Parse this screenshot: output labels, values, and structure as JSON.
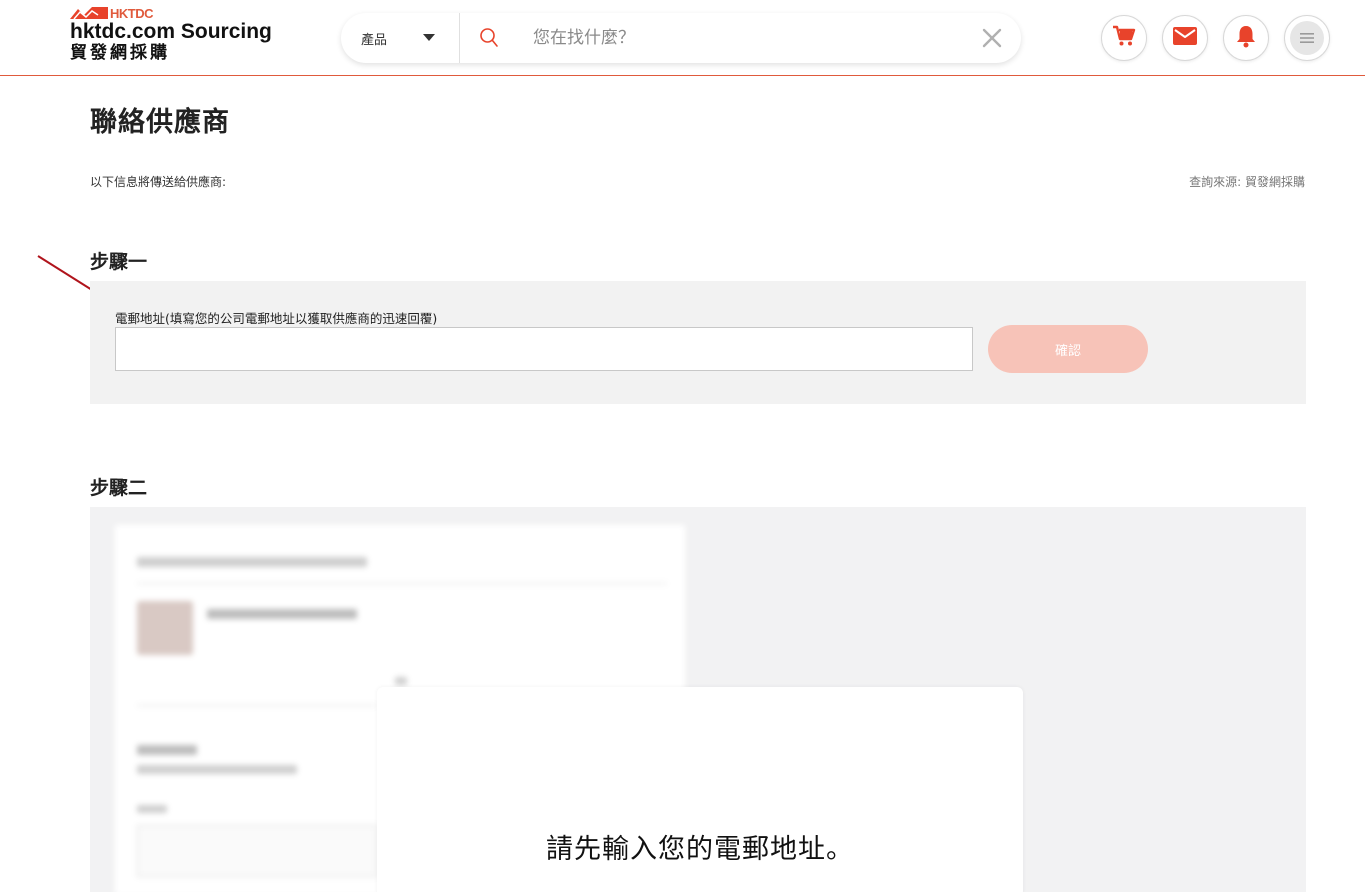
{
  "header": {
    "logo_brand": "HKTDC",
    "logo_title": "hktdc.com Sourcing",
    "logo_subtitle": "貿發網採購",
    "search": {
      "category": "產品",
      "placeholder": "您在找什麼？"
    },
    "icons": [
      "cart-icon",
      "mail-icon",
      "bell-icon",
      "menu-icon"
    ],
    "accent_color": "#e8432b"
  },
  "page": {
    "title": "聯絡供應商",
    "info_text": "以下信息將傳送給供應商:",
    "source_text": "查詢來源: 貿發網採購"
  },
  "step1": {
    "title": "步驟一",
    "email_label": "電郵地址(填寫您的公司電郵地址以獲取供應商的迅速回覆)",
    "email_value": "",
    "confirm_label": "確認",
    "confirm_color": "#f7c3b8"
  },
  "step2": {
    "title": "步驟二",
    "overlay_message": "請先輸入您的電郵地址。"
  }
}
